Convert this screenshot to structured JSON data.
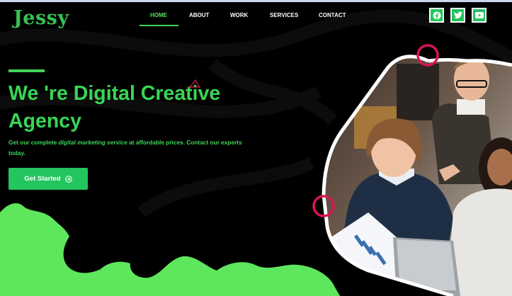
{
  "logo": {
    "text": "Jessy"
  },
  "nav": {
    "items": [
      {
        "label": "HOME",
        "active": true
      },
      {
        "label": "ABOUT",
        "active": false
      },
      {
        "label": "WORK",
        "active": false
      },
      {
        "label": "SERVICES",
        "active": false
      },
      {
        "label": "CONTACT",
        "active": false
      }
    ]
  },
  "social": [
    {
      "icon": "facebook-icon"
    },
    {
      "icon": "twitter-icon"
    },
    {
      "icon": "youtube-icon"
    }
  ],
  "hero": {
    "title_line1": "We 're Digital Creative",
    "title_line2": "Agency",
    "desc_part1": "Get our complete ",
    "desc_emphasis": "digital marketing",
    "desc_part2": " service at affordable prices. Contact our experts today.",
    "cta_label": "Get Started",
    "cta_icon": "arrow-circle-right-icon"
  },
  "colors": {
    "accent_green": "#38d556",
    "button_green": "#22c55e",
    "blob_green": "#5ee65d",
    "ring_red": "#d8164f",
    "background": "#000000"
  }
}
